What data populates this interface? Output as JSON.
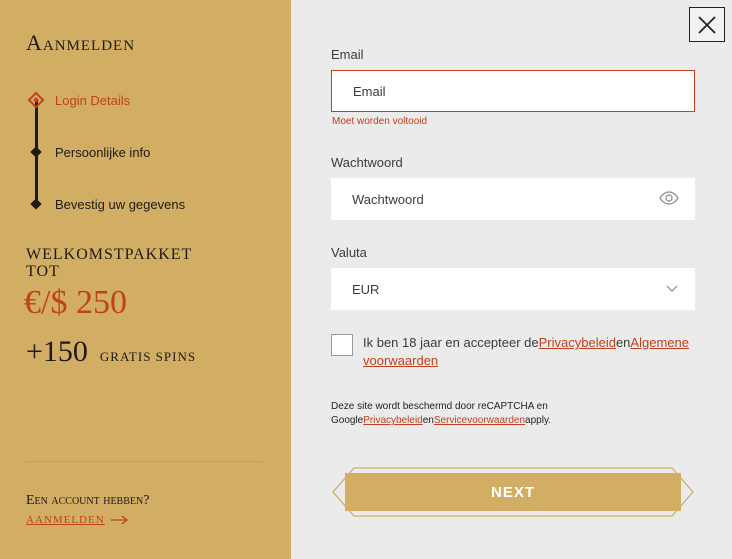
{
  "left": {
    "title": "Aanmelden",
    "steps": [
      "Login Details",
      "Persoonlijke info",
      "Bevestig uw gegevens"
    ],
    "promo": {
      "heading": "Welkomstpakket tot",
      "amount": "€/$ 250",
      "spins_count": "+150",
      "spins_label": "gratis spins"
    },
    "account_question": "Een account hebben?",
    "login_link": "Aanmelden"
  },
  "form": {
    "email_label": "Email",
    "email_placeholder": "Email",
    "email_error": "Moet worden voltooid",
    "password_label": "Wachtwoord",
    "password_placeholder": "Wachtwoord",
    "currency_label": "Valuta",
    "currency_value": "EUR",
    "consent_text_1": "Ik ben 18 jaar en accepteer de",
    "consent_link_1": "Privacybeleid",
    "consent_text_2": "en",
    "consent_link_2": "Algemene voorwaarden",
    "recaptcha_text_1": "Deze site wordt beschermd door reCAPTCHA en Google",
    "recaptcha_link_1": "Privacybeleid",
    "recaptcha_text_2": "en",
    "recaptcha_link_2": "Servicevoorwaarden",
    "recaptcha_text_3": "apply.",
    "next_label": "NEXT"
  },
  "icons": {
    "close": "close-icon",
    "eye": "eye-icon",
    "chevron": "chevron-down-icon",
    "arrow": "arrow-right-icon"
  },
  "colors": {
    "panel": "#d2ae65",
    "accent": "#c1401e",
    "background": "#ebebeb"
  }
}
